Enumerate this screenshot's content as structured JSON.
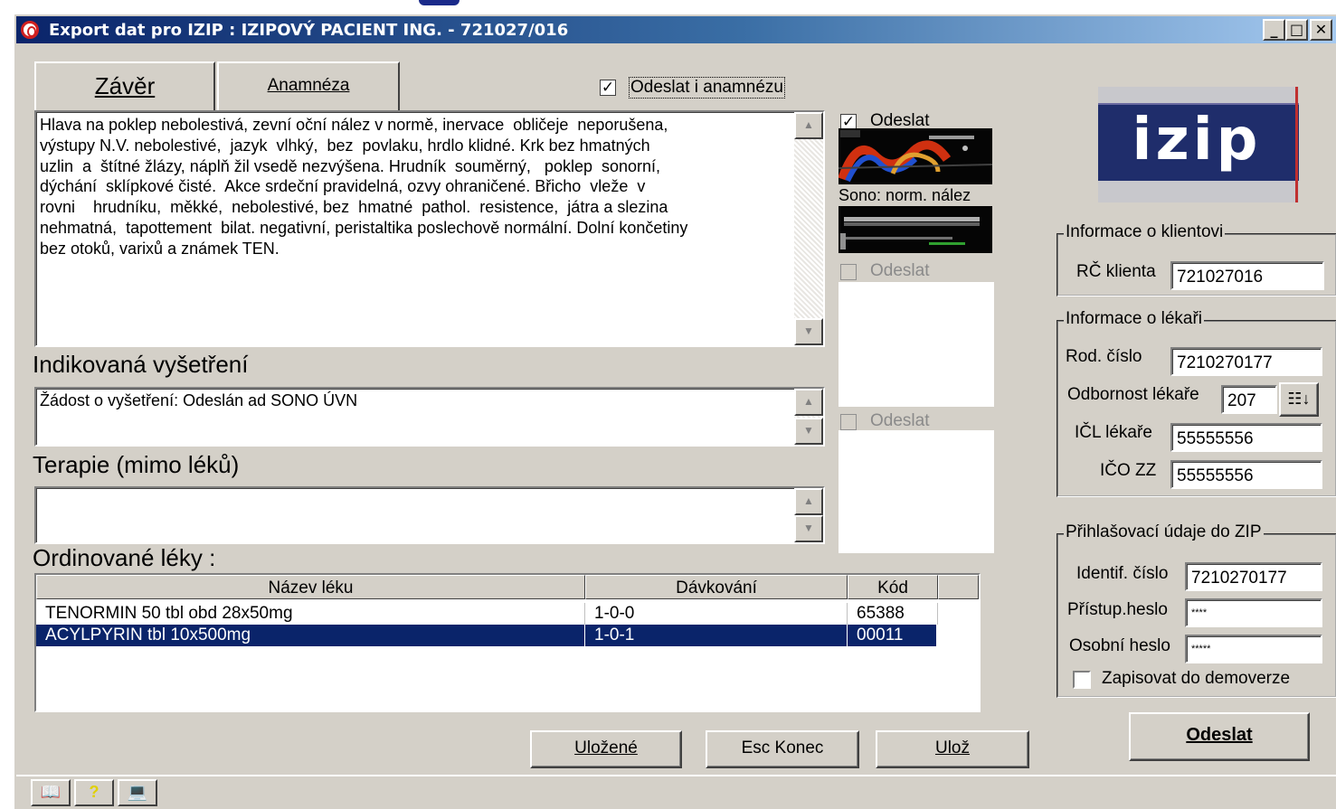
{
  "window": {
    "title": "Export dat pro IZIP : IZIPOVÝ PACIENT ING. - 721027/016",
    "buttons": {
      "minimize": "_",
      "maximize": "□",
      "close": "✕"
    }
  },
  "tabs": [
    {
      "label": "Závěr",
      "active": true
    },
    {
      "label": "Anamnéza",
      "active": false
    }
  ],
  "send_anamnesis": {
    "label": "Odeslat i anamnézu",
    "checked": true
  },
  "conclusion": {
    "text": "Hlava na poklep nebolestivá, zevní oční nález v normě, inervace  obličeje  neporušena,\nvýstupy N.V. nebolestivé,  jazyk  vlhký,  bez  povlaku, hrdlo klidné. Krk bez hmatných\nuzlin  a  štítné žlázy, náplň žil vsedě nezvýšena. Hrudník  souměrný,   poklep  sonorní,\ndýchání  sklípkové čisté.  Akce srdeční pravidelná, ozvy ohraničené. Břicho  vleže  v\nrovni    hrudníku,  měkké,  nebolestivé, bez  hmatné  pathol.  resistence,  játra a slezina\nnehmatná,  tapottement  bilat. negativní, peristaltika poslechově normální. Dolní končetiny\nbez otoků, varixů a známek TEN."
  },
  "indicated_exams": {
    "heading": "Indikovaná vyšetření",
    "text": "Žádost o vyšetření: Odeslán ad SONO ÚVN"
  },
  "therapy": {
    "heading": "Terapie (mimo léků)",
    "text": ""
  },
  "medications": {
    "heading": "Ordinované léky :",
    "columns": [
      "Název léku",
      "Dávkování",
      "Kód"
    ],
    "rows": [
      {
        "name": "TENORMIN 50 tbl obd 28x50mg",
        "dosage": "1-0-0",
        "code": "65388",
        "selected": false
      },
      {
        "name": "ACYLPYRIN tbl 10x500mg",
        "dosage": "1-0-1",
        "code": "00011",
        "selected": true
      }
    ]
  },
  "images": [
    {
      "send_label": "Odeslat",
      "checked": true,
      "enabled": true,
      "caption": "Sono: norm. nález"
    },
    {
      "send_label": "Odeslat",
      "checked": false,
      "enabled": false,
      "caption": ""
    },
    {
      "send_label": "Odeslat",
      "checked": false,
      "enabled": false,
      "caption": ""
    }
  ],
  "logo": {
    "text": "izip",
    "color": "#1f2d6b"
  },
  "client_info": {
    "title": "Informace o klientovi",
    "rc_label": "RČ klienta",
    "rc_value": "721027016"
  },
  "doctor_info": {
    "title": "Informace o lékaři",
    "rod_cislo_label": "Rod. číslo",
    "rod_cislo_value": "7210270177",
    "odbornost_label": "Odbornost lékaře",
    "odbornost_value": "207",
    "icl_label": "IČL lékaře",
    "icl_value": "55555556",
    "ico_label": "IČO ZZ",
    "ico_value": "55555556"
  },
  "login": {
    "title": "Přihlašovací údaje do ZIP",
    "ident_label": "Identif. číslo",
    "ident_value": "7210270177",
    "access_label": "Přístup.heslo",
    "access_value": "****",
    "personal_label": "Osobní heslo",
    "personal_value": "*****",
    "demo_label": "Zapisovat do demoverze",
    "demo_checked": false
  },
  "buttons": {
    "saved": "Uložené",
    "end": "Esc Konec",
    "save": "Ulož",
    "send": "Odeslat"
  },
  "colors": {
    "title_bar": "#0a246a",
    "face": "#d4d0c8",
    "selection": "#0a246a"
  }
}
